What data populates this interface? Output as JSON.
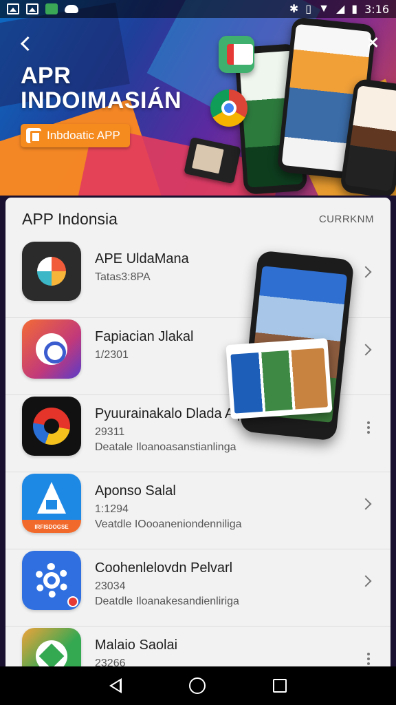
{
  "status_bar": {
    "time": "3:16",
    "left_icons": [
      "image-icon",
      "gallery-icon",
      "store-icon",
      "cloud-icon"
    ],
    "right_icons": [
      "bluetooth-icon",
      "vibrate-icon",
      "wifi-icon",
      "signal-icon",
      "battery-icon"
    ]
  },
  "hero": {
    "title_line1": "APR",
    "title_line2": "INDOIMASIÁN",
    "cta_label": "Inbdoatic APP",
    "accent": "#f58a1f"
  },
  "list_header": {
    "title": "APP Indonsia",
    "action": "CURRKNM"
  },
  "apps": [
    {
      "name": "APE UldaMana",
      "meta": "Tatas3:8PA",
      "desc": "",
      "trailing": "chevron"
    },
    {
      "name": "Fapiacian Jlakal",
      "meta": "1/2301",
      "desc": "",
      "trailing": "chevron"
    },
    {
      "name": "Pyuurainakalo Dlada Alpau",
      "meta": "29311",
      "desc": "Deatale Iloanoasanstianlinga",
      "trailing": "menu"
    },
    {
      "name": "Aponso Salal",
      "meta": "1:1294",
      "desc": "Veatdle IOooaneniondenniliga",
      "trailing": "chevron",
      "icon_caption": "IRFISDOGSE"
    },
    {
      "name": "Coohenlelovdn Pelvarl",
      "meta": "23034",
      "desc": "Deatdle Iloanakesandienliriga",
      "trailing": "chevron"
    },
    {
      "name": "Malaio Saolai",
      "meta": "23266",
      "desc": "",
      "trailing": "menu"
    }
  ],
  "colors": {
    "card_bg": "#f2f2f2",
    "hero_gradient_start": "#0d6cc4",
    "hero_gradient_end": "#d64a3a"
  }
}
